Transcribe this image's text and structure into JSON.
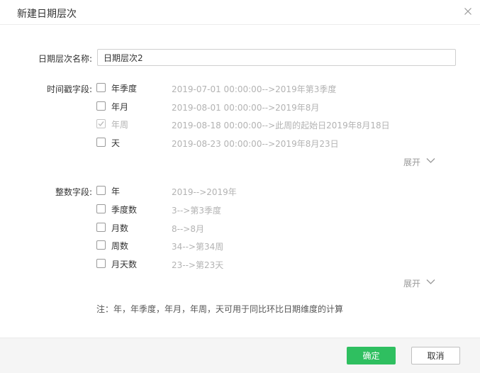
{
  "dialog": {
    "title": "新建日期层次"
  },
  "form": {
    "name_label": "日期层次名称:",
    "name_value": "日期层次2",
    "timestamp_label": "时间戳字段:",
    "timestamp_options": [
      {
        "label": "年季度",
        "example": "2019-07-01 00:00:00-->2019年第3季度",
        "checked": false,
        "disabled": false
      },
      {
        "label": "年月",
        "example": "2019-08-01 00:00:00-->2019年8月",
        "checked": false,
        "disabled": false
      },
      {
        "label": "年周",
        "example": "2019-08-18 00:00:00-->此周的起始日2019年8月18日",
        "checked": true,
        "disabled": true
      },
      {
        "label": "天",
        "example": "2019-08-23 00:00:00-->2019年8月23日",
        "checked": false,
        "disabled": false
      }
    ],
    "integer_label": "整数字段:",
    "integer_options": [
      {
        "label": "年",
        "example": "2019-->2019年",
        "checked": false
      },
      {
        "label": "季度数",
        "example": "3-->第3季度",
        "checked": false
      },
      {
        "label": "月数",
        "example": "8-->8月",
        "checked": false
      },
      {
        "label": "周数",
        "example": "34-->第34周",
        "checked": false
      },
      {
        "label": "月天数",
        "example": "23-->第23天",
        "checked": false
      }
    ],
    "expand_label": "展开",
    "note": "注：年，年季度，年月，年周，天可用于同比环比日期维度的计算"
  },
  "footer": {
    "ok_label": "确定",
    "cancel_label": "取消"
  },
  "colors": {
    "primary": "#2fbf60",
    "muted_text": "#b3b3b3"
  },
  "icons": {
    "close": "close-icon",
    "expand": "chevron-down-icon",
    "check": "check-icon"
  }
}
